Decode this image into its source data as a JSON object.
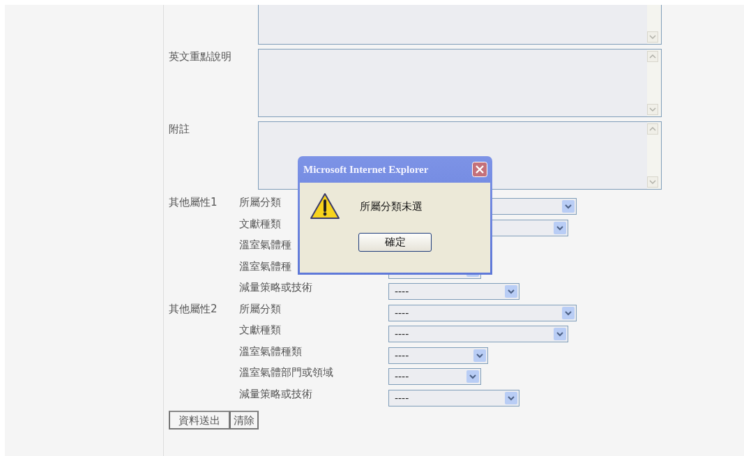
{
  "textareas": [
    {
      "top_cut": true
    },
    {
      "label": "英文重點說明",
      "top_cut": false
    },
    {
      "label": "附註",
      "top_cut": false
    }
  ],
  "attribute_groups": [
    {
      "title": "其他屬性1",
      "rows": [
        {
          "label": "所屬分類",
          "has_select": true
        },
        {
          "label": "文獻種類",
          "has_select": true
        },
        {
          "label": "溫室氣體種",
          "has_select": false
        },
        {
          "label": "溫室氣體種",
          "has_select": true
        },
        {
          "label": "減量策略或技術",
          "has_select": true,
          "value": "----"
        }
      ]
    },
    {
      "title": "其他屬性2",
      "rows": [
        {
          "label": "所屬分類",
          "has_select": true,
          "value": "----"
        },
        {
          "label": "文獻種類",
          "has_select": true,
          "value": "----"
        },
        {
          "label": "溫室氣體種類",
          "has_select": true,
          "value": "----"
        },
        {
          "label": "溫室氣體部門或領域",
          "has_select": true,
          "value": "----"
        },
        {
          "label": "減量策略或技術",
          "has_select": true,
          "value": "----"
        }
      ]
    }
  ],
  "buttons": [
    "資料送出",
    "清除"
  ],
  "dialog": {
    "title": "Microsoft Internet Explorer",
    "message": "所屬分類未選",
    "button": "確定"
  }
}
